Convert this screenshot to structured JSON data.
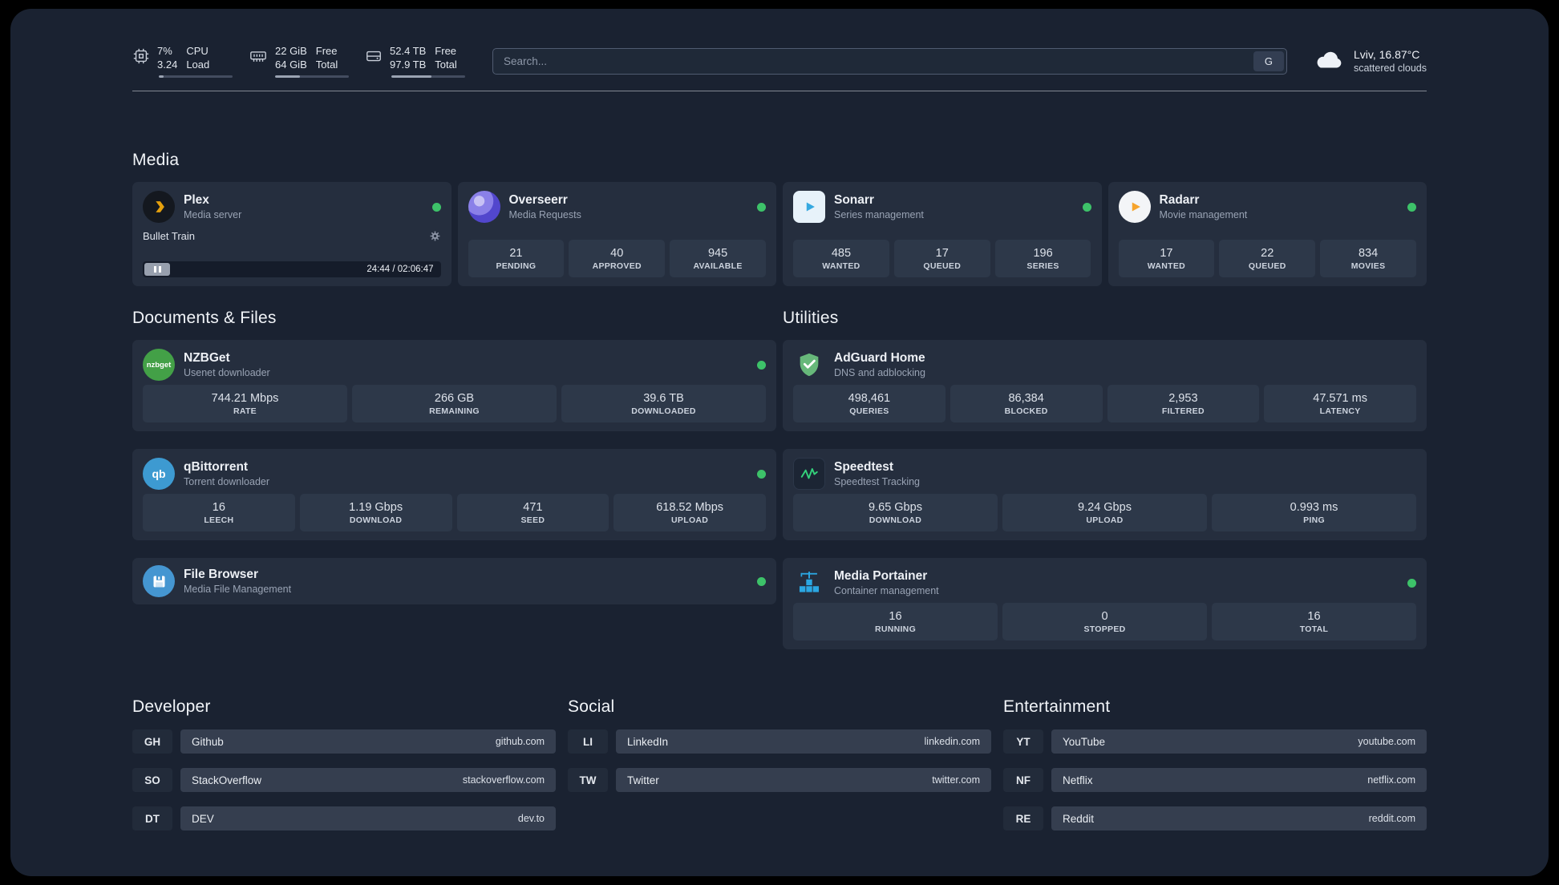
{
  "header": {
    "cpu": {
      "percent": "7%",
      "load": "3.24",
      "title": "CPU",
      "subtitle": "Load"
    },
    "memory": {
      "free": "22 GiB",
      "total": "64 GiB",
      "free_label": "Free",
      "total_label": "Total"
    },
    "disk": {
      "free": "52.4 TB",
      "total": "97.9 TB",
      "free_label": "Free",
      "total_label": "Total"
    },
    "search": {
      "placeholder": "Search...",
      "shortcut": "G"
    },
    "weather": {
      "location": "Lviv, 16.87°C",
      "condition": "scattered clouds"
    }
  },
  "media": {
    "heading": "Media",
    "plex": {
      "name": "Plex",
      "subtitle": "Media server",
      "now_playing": "Bullet Train",
      "time": "24:44 / 02:06:47"
    },
    "overseerr": {
      "name": "Overseerr",
      "subtitle": "Media Requests",
      "stats": [
        {
          "value": "21",
          "label": "PENDING"
        },
        {
          "value": "40",
          "label": "APPROVED"
        },
        {
          "value": "945",
          "label": "AVAILABLE"
        }
      ]
    },
    "sonarr": {
      "name": "Sonarr",
      "subtitle": "Series management",
      "stats": [
        {
          "value": "485",
          "label": "WANTED"
        },
        {
          "value": "17",
          "label": "QUEUED"
        },
        {
          "value": "196",
          "label": "SERIES"
        }
      ]
    },
    "radarr": {
      "name": "Radarr",
      "subtitle": "Movie management",
      "stats": [
        {
          "value": "17",
          "label": "WANTED"
        },
        {
          "value": "22",
          "label": "QUEUED"
        },
        {
          "value": "834",
          "label": "MOVIES"
        }
      ]
    }
  },
  "documents": {
    "heading": "Documents & Files",
    "nzbget": {
      "name": "NZBGet",
      "subtitle": "Usenet downloader",
      "stats": [
        {
          "value": "744.21 Mbps",
          "label": "RATE"
        },
        {
          "value": "266 GB",
          "label": "REMAINING"
        },
        {
          "value": "39.6 TB",
          "label": "DOWNLOADED"
        }
      ]
    },
    "qbittorrent": {
      "name": "qBittorrent",
      "subtitle": "Torrent downloader",
      "stats": [
        {
          "value": "16",
          "label": "LEECH"
        },
        {
          "value": "1.19 Gbps",
          "label": "DOWNLOAD"
        },
        {
          "value": "471",
          "label": "SEED"
        },
        {
          "value": "618.52 Mbps",
          "label": "UPLOAD"
        }
      ]
    },
    "filebrowser": {
      "name": "File Browser",
      "subtitle": "Media File Management"
    }
  },
  "utilities": {
    "heading": "Utilities",
    "adguard": {
      "name": "AdGuard Home",
      "subtitle": "DNS and adblocking",
      "stats": [
        {
          "value": "498,461",
          "label": "QUERIES"
        },
        {
          "value": "86,384",
          "label": "BLOCKED"
        },
        {
          "value": "2,953",
          "label": "FILTERED"
        },
        {
          "value": "47.571 ms",
          "label": "LATENCY"
        }
      ]
    },
    "speedtest": {
      "name": "Speedtest",
      "subtitle": "Speedtest Tracking",
      "stats": [
        {
          "value": "9.65 Gbps",
          "label": "DOWNLOAD"
        },
        {
          "value": "9.24 Gbps",
          "label": "UPLOAD"
        },
        {
          "value": "0.993 ms",
          "label": "PING"
        }
      ]
    },
    "portainer": {
      "name": "Media Portainer",
      "subtitle": "Container management",
      "stats": [
        {
          "value": "16",
          "label": "RUNNING"
        },
        {
          "value": "0",
          "label": "STOPPED"
        },
        {
          "value": "16",
          "label": "TOTAL"
        }
      ]
    }
  },
  "bookmarks": {
    "developer": {
      "heading": "Developer",
      "items": [
        {
          "abbr": "GH",
          "name": "Github",
          "url": "github.com"
        },
        {
          "abbr": "SO",
          "name": "StackOverflow",
          "url": "stackoverflow.com"
        },
        {
          "abbr": "DT",
          "name": "DEV",
          "url": "dev.to"
        }
      ]
    },
    "social": {
      "heading": "Social",
      "items": [
        {
          "abbr": "LI",
          "name": "LinkedIn",
          "url": "linkedin.com"
        },
        {
          "abbr": "TW",
          "name": "Twitter",
          "url": "twitter.com"
        }
      ]
    },
    "entertainment": {
      "heading": "Entertainment",
      "items": [
        {
          "abbr": "YT",
          "name": "YouTube",
          "url": "youtube.com"
        },
        {
          "abbr": "NF",
          "name": "Netflix",
          "url": "netflix.com"
        },
        {
          "abbr": "RE",
          "name": "Reddit",
          "url": "reddit.com"
        }
      ]
    }
  },
  "colors": {
    "status_online": "#3dc269",
    "plex_accent": "#e5a00d"
  }
}
